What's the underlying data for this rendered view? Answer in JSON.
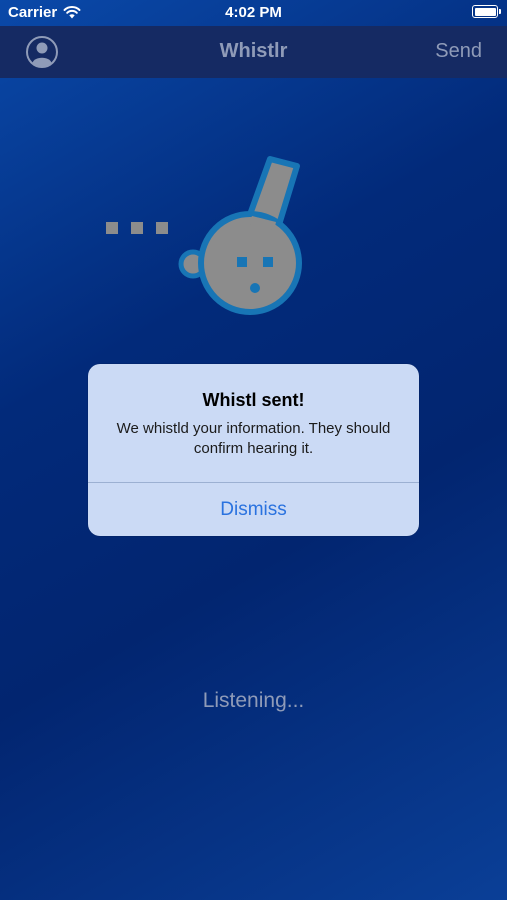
{
  "status_bar": {
    "carrier": "Carrier",
    "time": "4:02 PM",
    "wifi_icon": "wifi-icon",
    "battery_icon": "battery-icon"
  },
  "nav": {
    "title": "Whistlr",
    "profile_icon": "user-profile-icon",
    "send_label": "Send"
  },
  "illustration": {
    "icon": "whistle-icon",
    "sound_dots": 3
  },
  "alert": {
    "title": "Whistl sent!",
    "message": "We whistld your information. They should confirm hearing it.",
    "dismiss_label": "Dismiss"
  },
  "main": {
    "status_text": "Listening..."
  },
  "colors": {
    "background_top": "#0a49a9",
    "background_mid": "#022570",
    "nav_bar": "#152a63",
    "nav_text": "#8f9bb8",
    "whistle_fill": "#8c8c8c",
    "whistle_outline": "#1875b5",
    "alert_background": "#d6e4fc",
    "alert_button": "#2a72df"
  }
}
